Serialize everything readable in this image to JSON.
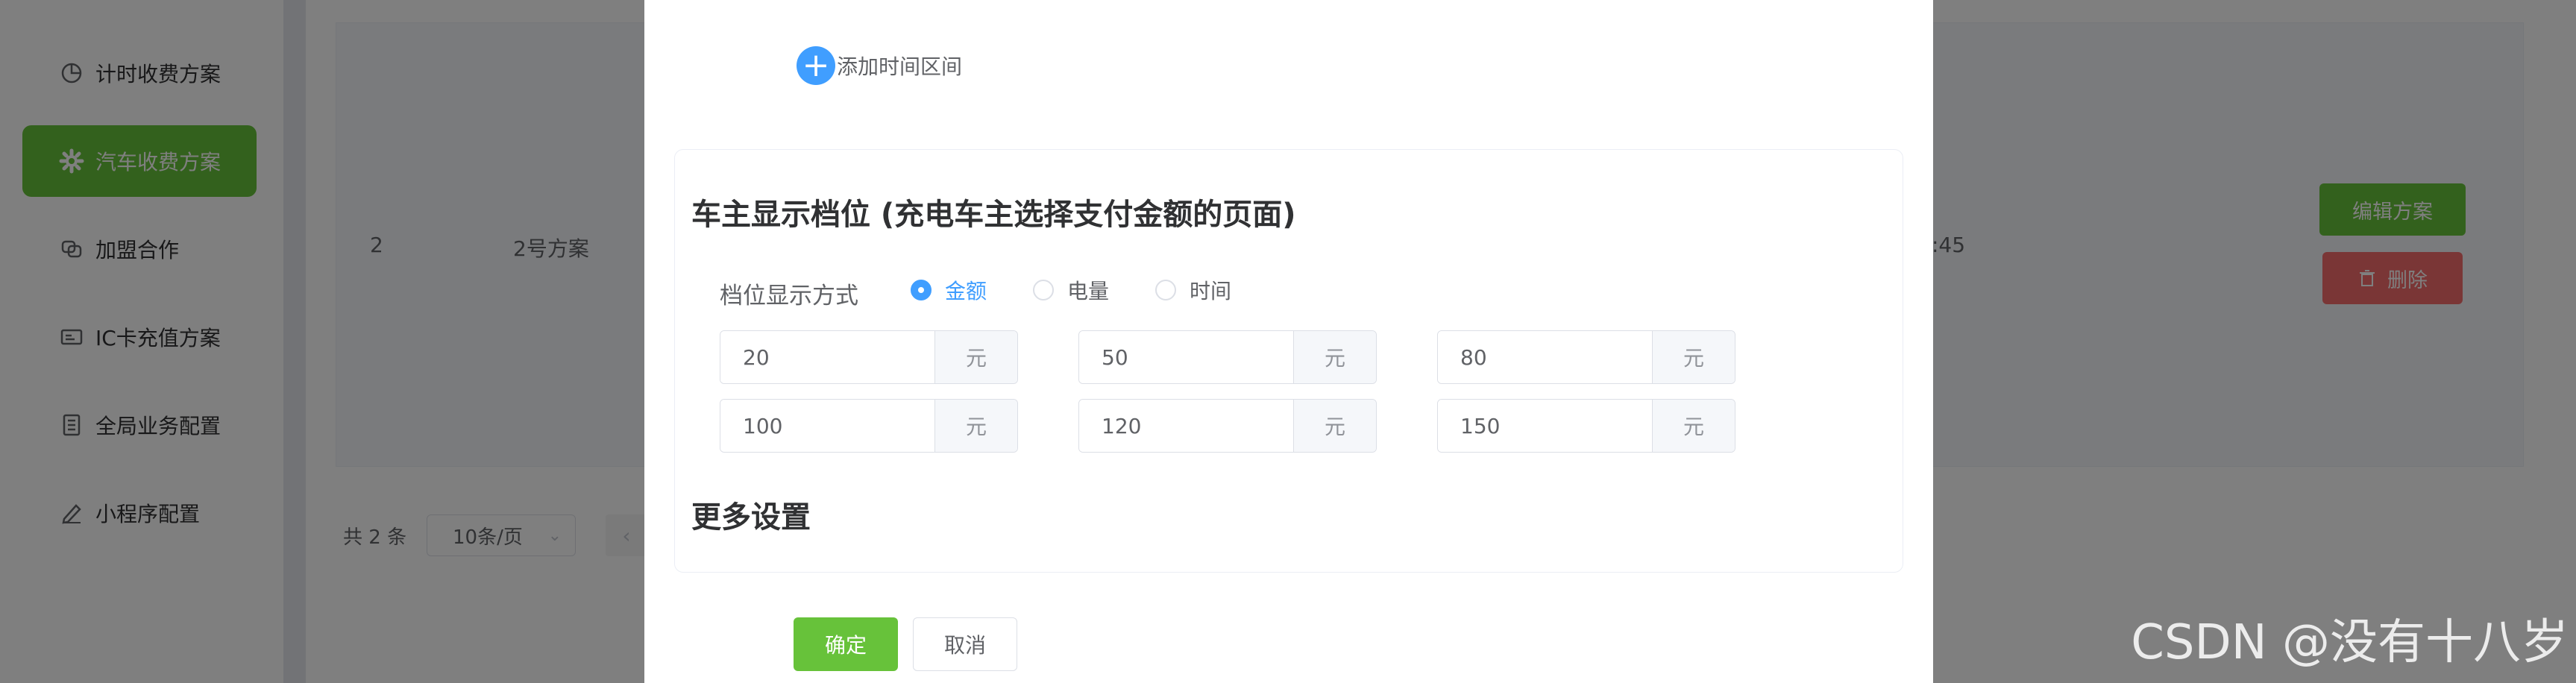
{
  "sidebar": {
    "items": [
      {
        "label": "计时收费方案",
        "icon": "pie-chart-icon",
        "active": false
      },
      {
        "label": "汽车收费方案",
        "icon": "gear-icon",
        "active": true
      },
      {
        "label": "加盟合作",
        "icon": "link-icon",
        "active": false
      },
      {
        "label": "IC卡充值方案",
        "icon": "card-icon",
        "active": false
      },
      {
        "label": "全局业务配置",
        "icon": "document-icon",
        "active": false
      },
      {
        "label": "小程序配置",
        "icon": "pen-icon",
        "active": false
      }
    ]
  },
  "table": {
    "row": {
      "index": "2",
      "name": "2号方案",
      "time_fragment": ":45"
    },
    "edit_label": "编辑方案",
    "delete_label": "删除"
  },
  "pagination": {
    "total": "共 2 条",
    "page_size": "10条/页"
  },
  "dialog": {
    "add_range_label": "添加时间区间",
    "card_title": "车主显示档位 (充电车主选择支付金额的页面)",
    "display_mode_label": "档位显示方式",
    "radio_options": [
      "金额",
      "电量",
      "时间"
    ],
    "selected_option": "金额",
    "tiers": [
      {
        "value": "20",
        "unit": "元"
      },
      {
        "value": "50",
        "unit": "元"
      },
      {
        "value": "80",
        "unit": "元"
      },
      {
        "value": "100",
        "unit": "元"
      },
      {
        "value": "120",
        "unit": "元"
      },
      {
        "value": "150",
        "unit": "元"
      }
    ],
    "more_settings_title": "更多设置",
    "confirm_label": "确定",
    "cancel_label": "取消"
  },
  "watermark": "CSDN @没有十八岁",
  "colors": {
    "accent_green": "#67c23a",
    "primary_blue": "#409eff",
    "danger_red": "#f56c6c"
  }
}
